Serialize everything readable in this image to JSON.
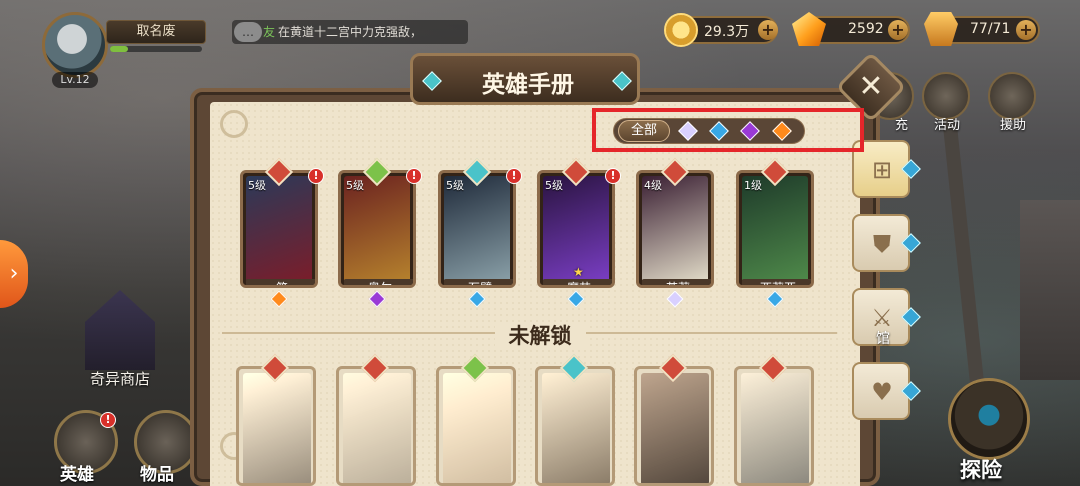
{
  "player": {
    "level": "Lv.12",
    "name": "取名废",
    "exp_fraction": 0.2
  },
  "chat": {
    "tag": "友",
    "message": "在黄道十二宫中力克强敌，"
  },
  "resources": {
    "gold": {
      "value": "29.3万",
      "plus": "+"
    },
    "gems": {
      "value": "2592",
      "plus": "+"
    },
    "stamina": {
      "value": "77/71",
      "plus": "+"
    }
  },
  "side_labels": {
    "shop": "奇异商店",
    "shield_hall": "馆",
    "charge": "充",
    "activity": "活动",
    "help": "援助"
  },
  "bottom_nav": {
    "hero": "英雄",
    "items": "物品",
    "explore": "探险"
  },
  "panel": {
    "title": "英雄手册",
    "close": "✕",
    "filter": {
      "all_label": "全部",
      "gems": [
        {
          "name": "white-gem",
          "color": "#d9d0ff"
        },
        {
          "name": "blue-gem",
          "color": "#38a8e6"
        },
        {
          "name": "purple-gem",
          "color": "#9a3ad6"
        },
        {
          "name": "orange-gem",
          "color": "#ff8a1c"
        }
      ]
    },
    "heroes": [
      {
        "level": "5级",
        "name": "简",
        "rarity_color": "#ff8a1c",
        "badge_color": "#d04b3a",
        "art": [
          "#2b3a59",
          "#7b1d2a"
        ],
        "alert": "!"
      },
      {
        "level": "5级",
        "name": "奥尔",
        "rarity_color": "#9a3ad6",
        "badge_color": "#7cc24a",
        "art": [
          "#6b2220",
          "#b6822d"
        ],
        "alert": "!"
      },
      {
        "level": "5级",
        "name": "石臂",
        "rarity_color": "#38a8e6",
        "badge_color": "#4ac3c9",
        "art": [
          "#1f2a3a",
          "#8aa0a8"
        ],
        "alert": "!"
      },
      {
        "level": "5级",
        "name": "魔芯",
        "rarity_color": "#38a8e6",
        "badge_color": "#d04b3a",
        "art": [
          "#2a1440",
          "#7a3ec4"
        ],
        "alert": "!",
        "star": "★"
      },
      {
        "level": "4级",
        "name": "茉莉",
        "rarity_color": "#d9d0ff",
        "badge_color": "#d04b3a",
        "art": [
          "#3a1f33",
          "#e2dcc8"
        ]
      },
      {
        "level": "1级",
        "name": "西莉亚",
        "rarity_color": "#38a8e6",
        "badge_color": "#d04b3a",
        "art": [
          "#1e3a2a",
          "#4f8a4a"
        ]
      }
    ],
    "locked_title": "未解锁",
    "locked": [
      {
        "badge_color": "#d04b3a",
        "art": [
          "#f0e6d2",
          "#8c7b6a"
        ]
      },
      {
        "badge_color": "#d04b3a",
        "art": [
          "#e9dfcb",
          "#a79a86"
        ]
      },
      {
        "badge_color": "#7cc24a",
        "art": [
          "#f5e2c6",
          "#c9a47a"
        ]
      },
      {
        "badge_color": "#4ac3c9",
        "art": [
          "#e4d6bc",
          "#8a6a4a"
        ]
      },
      {
        "badge_color": "#d04b3a",
        "art": [
          "#c98a6a",
          "#5a3a2a"
        ]
      },
      {
        "badge_color": "#d04b3a",
        "art": [
          "#d9d6cc",
          "#6f7a80"
        ]
      }
    ]
  }
}
